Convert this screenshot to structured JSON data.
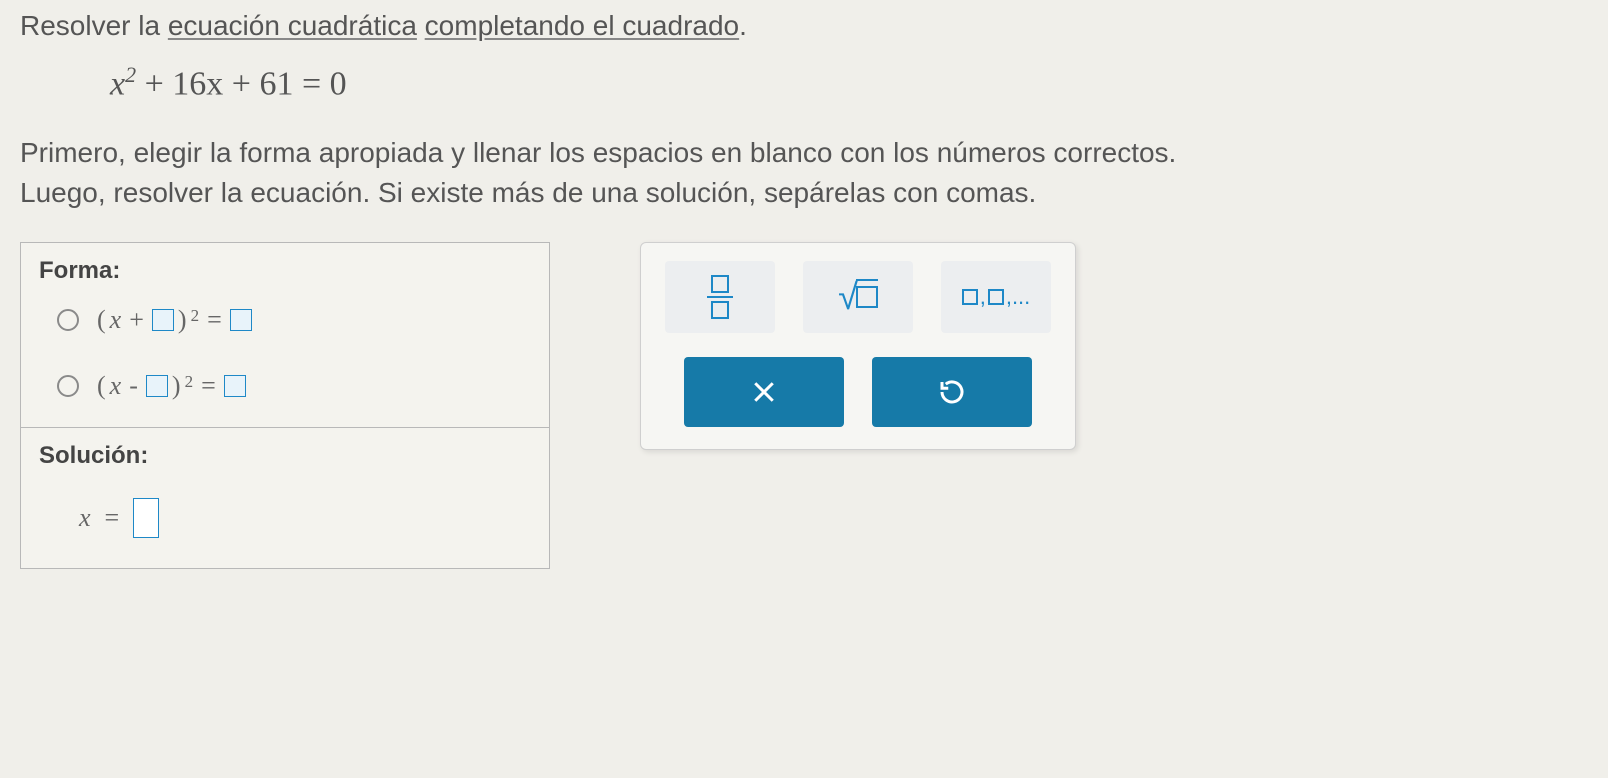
{
  "problem": {
    "prefix": "Resolver la ",
    "link1": "ecuación cuadrática",
    "mid": " ",
    "link2": "completando el cuadrado",
    "suffix": ".",
    "equation": {
      "latex": "x^2 + 16x + 61 = 0",
      "display": {
        "var": "x",
        "squared": "2",
        "rest": " + 16x + 61 = 0",
        "b": "+16",
        "c": "+61",
        "eq": "= 0"
      }
    },
    "instructions_l1": "Primero, elegir la forma apropiada y llenar los espacios en blanco con los números correctos.",
    "instructions_l2": "Luego, resolver la ecuación. Si existe más de una solución, sepárelas con comas."
  },
  "forma": {
    "header": "Forma:",
    "options": [
      {
        "sign": "+",
        "lhs": "(x + □)^2",
        "eq": "=",
        "rhs": "□"
      },
      {
        "sign": "-",
        "lhs": "(x - □)^2",
        "eq": "=",
        "rhs": "□"
      }
    ]
  },
  "solucion": {
    "header": "Solución:",
    "var": "x",
    "eq": "="
  },
  "toolbox": {
    "fraction": "fraction",
    "sqrt": "square-root",
    "list": "list-separator",
    "list_glyph": ",",
    "list_trail": ",...",
    "clear": "clear",
    "reset": "reset"
  }
}
